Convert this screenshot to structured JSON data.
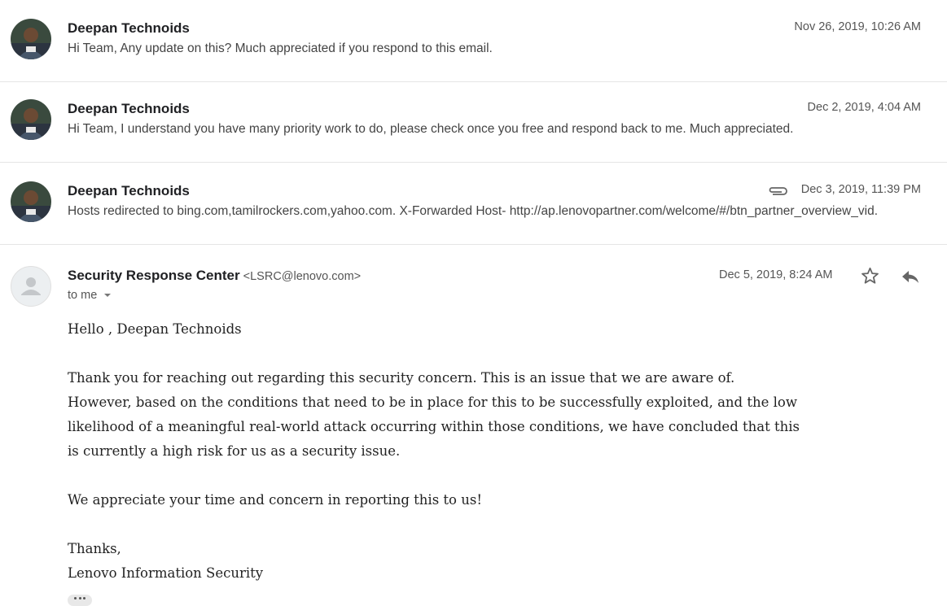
{
  "thread": [
    {
      "sender": "Deepan Technoids",
      "date": "Nov 26, 2019, 10:26 AM",
      "snippet": "Hi Team, Any update on this? Much appreciated if you respond to this email.",
      "has_attachment": false
    },
    {
      "sender": "Deepan Technoids",
      "date": "Dec 2, 2019, 4:04 AM",
      "snippet": "Hi Team, I understand you have many priority work to do, please check once you free and respond back to me. Much appreciated.",
      "has_attachment": false
    },
    {
      "sender": "Deepan Technoids",
      "date": "Dec 3, 2019, 11:39 PM",
      "snippet": "Hosts redirected to bing.com,tamilrockers.com,yahoo.com. X-Forwarded Host- http://ap.lenovopartner.com/welcome/#/btn_partner_overview_vid.",
      "has_attachment": true,
      "attachment_icon": "paperclip-icon"
    }
  ],
  "open_message": {
    "sender": "Security Response Center",
    "email": "<LSRC@lenovo.com>",
    "to": "to me",
    "date": "Dec 5, 2019, 8:24 AM",
    "greeting": "Hello , Deepan Technoids",
    "paragraph1_lines": [
      "Thank you for reaching out regarding this security concern.   This is an issue that we are aware of.",
      "However, based on the conditions that need to be in place for this to be successfully exploited, and the low",
      "likelihood of a meaningful real-world attack occurring within those conditions, we have concluded that this",
      "is currently a high risk for us as a security issue."
    ],
    "paragraph2": "We appreciate your time and concern in reporting this to us!",
    "signoff": "Thanks,",
    "signature": "Lenovo Information Security",
    "icons": {
      "star": "star-icon",
      "reply": "reply-icon",
      "more": "more-icon",
      "dropdown": "chevron-down-icon"
    }
  },
  "colors": {
    "divider": "#e5e5e5",
    "sender": "#202124",
    "meta": "#555555"
  }
}
